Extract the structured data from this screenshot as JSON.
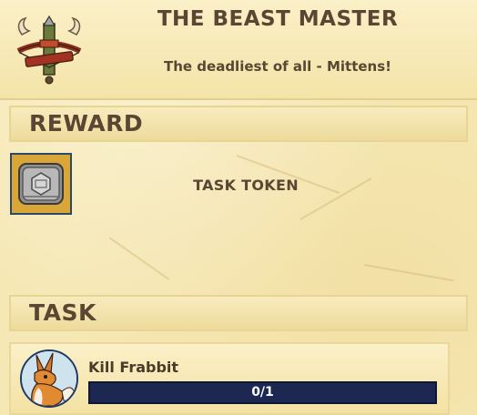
{
  "quest": {
    "title": "THE BEAST MASTER",
    "subtitle": "The deadliest of all - Mittens!",
    "icon": "crossed-bows-antlers-icon"
  },
  "reward": {
    "section_label": "REWARD",
    "item_name": "TASK TOKEN",
    "item_icon": "task-token-icon"
  },
  "task": {
    "section_label": "TASK",
    "items": [
      {
        "name": "Kill Frabbit",
        "avatar_icon": "frabbit-icon",
        "progress_text": "0/1",
        "progress_fraction": 0
      }
    ]
  },
  "colors": {
    "parchment": "#f6e8b4",
    "text": "#5a4632",
    "progress_bg": "#1c2752",
    "slot_bg": "#d9a637"
  }
}
